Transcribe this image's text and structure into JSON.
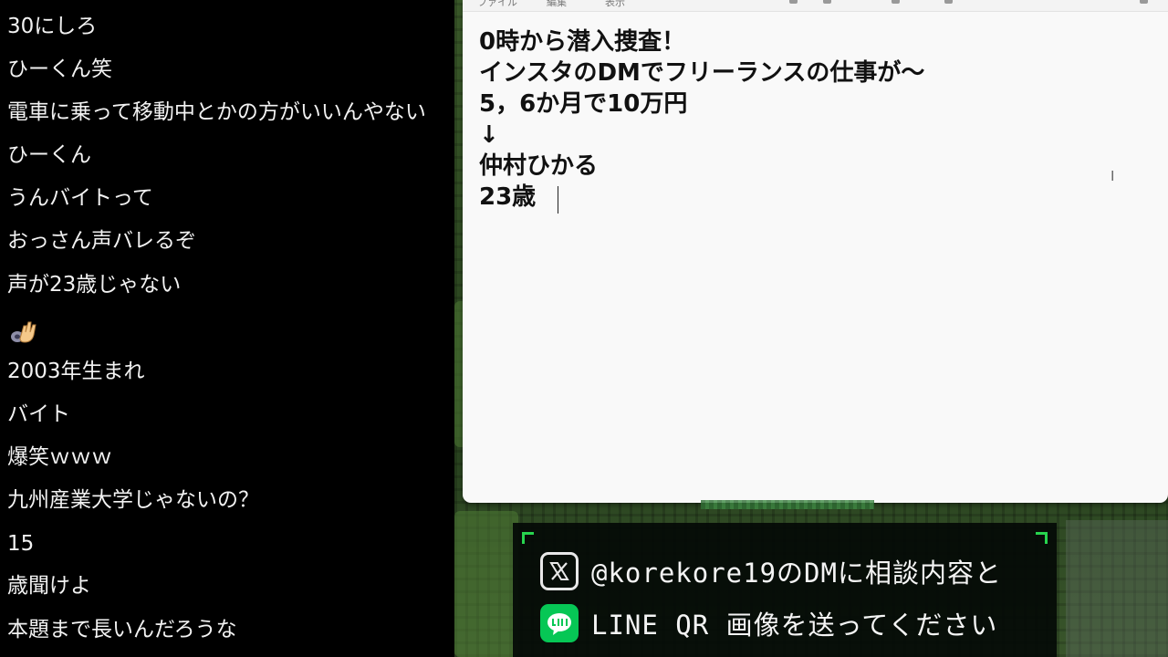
{
  "chat": {
    "messages": [
      "30にしろ",
      "ひーくん笑",
      "電車に乗って移動中とかの方がいいんやない",
      "ひーくん",
      "うんバイトって",
      "おっさん声バレるぞ",
      "声が23歳じゃない",
      "",
      "2003年生まれ",
      "バイト",
      "爆笑ｗｗｗ",
      "九州産業大学じゃないの？",
      "15",
      "歳聞けよ",
      "本題まで長いんだろうな"
    ],
    "wave_icon": "waving-hand-emoji"
  },
  "notepad": {
    "menu": [
      "ファイル",
      "編集",
      "表示"
    ],
    "lines": [
      "0時から潜入捜査！",
      "インスタのDMでフリーランスの仕事が～",
      "5，6か月で10万円",
      "↓",
      "仲村ひかる",
      "23歳"
    ]
  },
  "banner": {
    "x_text": "@korekore19のDMに相談内容と",
    "line_text": "LINE QR 画像を送ってください",
    "x_icon": "x-logo-icon",
    "line_icon": "line-logo-icon",
    "accent": "#27d44e",
    "line_green": "#06c755"
  }
}
